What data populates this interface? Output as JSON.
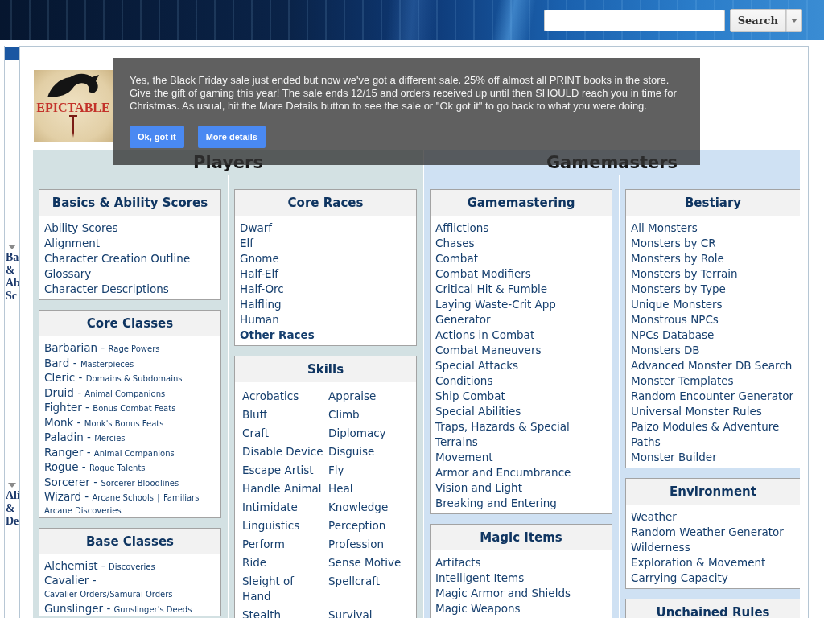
{
  "header": {
    "search_button": "Search"
  },
  "sidebar": {
    "sections": [
      {
        "label": "Ba & Ab Sc",
        "expanded": true
      },
      {
        "label": "Ali & De",
        "expanded": true
      }
    ]
  },
  "logo": {
    "wordmark": "EPICTABLE"
  },
  "notice": {
    "message": "Yes, the Black Friday sale just ended but now we've got a different sale. 25% off almost all PRINT books in the store. Give the gift of gaming this year! The sale ends 12/15 and orders received up until then SHOULD reach you in time for Christmas. As usual, hit the More Details button to see the sale or \"Ok got it\" to go back to what you were doing.",
    "buttons": [
      "Ok, got it",
      "More details"
    ]
  },
  "groups": [
    {
      "title": "Players",
      "color": "#d3e1e3",
      "columns": [
        [
          {
            "kind": "list",
            "title": "Basics & Ability Scores",
            "items": [
              "Ability Scores",
              "Alignment",
              "Character Creation Outline",
              "Glossary",
              "Character Descriptions"
            ]
          },
          {
            "kind": "classes",
            "title": "Core Classes",
            "items": [
              {
                "name": "Barbarian",
                "dash": "-",
                "links": [
                  {
                    "label": "Rage Powers"
                  }
                ]
              },
              {
                "name": "Bard",
                "dash": "-",
                "links": [
                  {
                    "label": "Masterpieces"
                  }
                ]
              },
              {
                "name": "Cleric",
                "dash": "-",
                "links": [
                  {
                    "label": "Domains & Subdomains"
                  }
                ]
              },
              {
                "name": "Druid",
                "dash": "-",
                "links": [
                  {
                    "label": "Animal Companions"
                  }
                ]
              },
              {
                "name": "Fighter",
                "dash": "-",
                "links": [
                  {
                    "label": "Bonus Combat Feats"
                  }
                ]
              },
              {
                "name": "Monk",
                "dash": "-",
                "links": [
                  {
                    "label": "Monk's Bonus Feats"
                  }
                ]
              },
              {
                "name": "Paladin",
                "dash": "-",
                "links": [
                  {
                    "label": "Mercies"
                  }
                ]
              },
              {
                "name": "Ranger",
                "dash": "-",
                "links": [
                  {
                    "label": "Animal Companions"
                  }
                ]
              },
              {
                "name": "Rogue",
                "dash": "-",
                "links": [
                  {
                    "label": "Rogue Talents"
                  }
                ]
              },
              {
                "name": "Sorcerer",
                "dash": "-",
                "links": [
                  {
                    "label": "Sorcerer Bloodlines"
                  }
                ]
              },
              {
                "name": "Wizard",
                "dash": "-",
                "links": [
                  {
                    "label": "Arcane Schools",
                    "sep": "|"
                  },
                  {
                    "label": "Familiars",
                    "sep": "|"
                  },
                  {
                    "label": "Arcane Discoveries"
                  }
                ]
              }
            ]
          },
          {
            "kind": "classes",
            "title": "Base Classes",
            "items": [
              {
                "name": "Alchemist",
                "dash": "-",
                "links": [
                  {
                    "label": "Discoveries"
                  }
                ]
              },
              {
                "name": "Cavalier",
                "dash": "-",
                "links": [
                  {
                    "label": "Cavalier Orders/Samurai Orders"
                  }
                ]
              },
              {
                "name": "Gunslinger",
                "dash": "-",
                "links": [
                  {
                    "label": "Gunslinger's Deeds"
                  }
                ]
              }
            ]
          }
        ],
        [
          {
            "kind": "list",
            "title": "Core Races",
            "items": [
              {
                "label": "Dwarf",
                "bold": false
              },
              {
                "label": "Elf",
                "bold": false
              },
              {
                "label": "Gnome",
                "bold": false
              },
              {
                "label": "Half-Elf",
                "bold": false
              },
              {
                "label": "Half-Orc",
                "bold": false
              },
              {
                "label": "Halfling",
                "bold": false
              },
              {
                "label": "Human",
                "bold": false
              },
              {
                "label": "Other Races",
                "bold": true
              }
            ]
          },
          {
            "kind": "grid",
            "title": "Skills",
            "items": [
              "Acrobatics",
              "Appraise",
              "Bluff",
              "Climb",
              "Craft",
              "Diplomacy",
              "Disable Device",
              "Disguise",
              "Escape Artist",
              "Fly",
              "Handle Animal",
              "Heal",
              "Intimidate",
              "Knowledge",
              "Linguistics",
              "Perception",
              "Perform",
              "Profession",
              "Ride",
              "Sense Motive",
              "Sleight of Hand",
              "Spellcraft",
              "Stealth",
              "Survival"
            ]
          }
        ]
      ]
    },
    {
      "title": "Gamemasters",
      "color": "#cfe1f3",
      "columns": [
        [
          {
            "kind": "list",
            "title": "Gamemastering",
            "items": [
              "Afflictions",
              "Chases",
              "Combat",
              "Combat Modifiers",
              "Critical Hit & Fumble",
              "Laying Waste-Crit App Generator",
              "Actions in Combat",
              "Combat Maneuvers",
              "Special Attacks",
              "Conditions",
              "Ship Combat",
              "Special Abilities",
              "Traps, Hazards & Special Terrains",
              "Movement",
              "Armor and Encumbrance",
              "Vision and Light",
              "Breaking and Entering"
            ]
          },
          {
            "kind": "list",
            "title": "Magic Items",
            "items": [
              "Artifacts",
              "Intelligent Items",
              "Magic Armor and Shields",
              "Magic Weapons"
            ]
          }
        ],
        [
          {
            "kind": "list",
            "title": "Bestiary",
            "items": [
              "All Monsters",
              "Monsters by CR",
              "Monsters by Role",
              "Monsters by Terrain",
              "Monsters by Type",
              "Unique Monsters",
              "Monstrous NPCs",
              "NPCs Database",
              "Monsters DB",
              "Advanced Monster DB Search",
              "Monster Templates",
              "Random Encounter Generator",
              "Universal Monster Rules",
              "Paizo Modules & Adventure Paths",
              "Monster Builder"
            ]
          },
          {
            "kind": "list",
            "title": "Environment",
            "items": [
              "Weather",
              "Random Weather Generator",
              "Wilderness",
              "Exploration & Movement",
              "Carrying Capacity"
            ]
          },
          {
            "kind": "list",
            "title": "Unchained Rules"
          }
        ]
      ]
    }
  ]
}
